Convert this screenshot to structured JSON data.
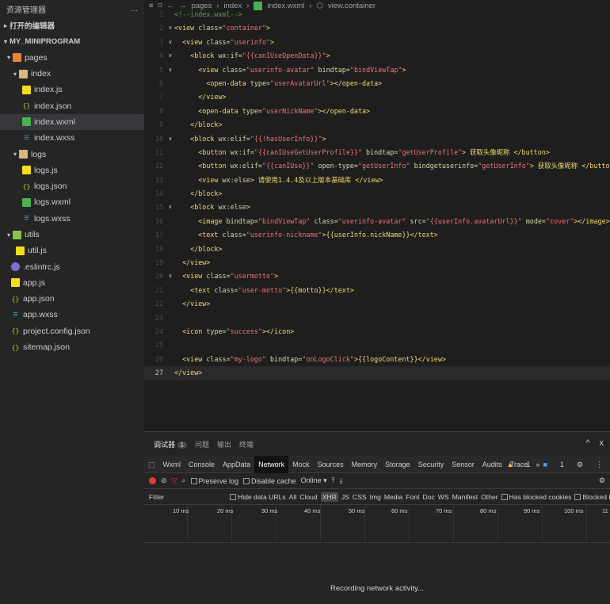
{
  "sidebar": {
    "title": "资源管理器",
    "more": "...",
    "sections": {
      "open_editors": "打开的编辑器",
      "project": "MY_MINIPROGRAM"
    },
    "tree": {
      "pages": "pages",
      "index": "index",
      "index_js": "index.js",
      "index_json": "index.json",
      "index_wxml": "index.wxml",
      "index_wxss": "index.wxss",
      "logs": "logs",
      "logs_js": "logs.js",
      "logs_json": "logs.json",
      "logs_wxml": "logs.wxml",
      "logs_wxss": "logs.wxss",
      "utils": "utils",
      "util_js": "util.js",
      "eslintrc": ".eslintrc.js",
      "app_js": "app.js",
      "app_json": "app.json",
      "app_wxss": "app.wxss",
      "project_config": "project.config.json",
      "sitemap": "sitemap.json"
    }
  },
  "breadcrumb": {
    "p1": "pages",
    "p2": "index",
    "p3": "index.wxml",
    "p4": "view.container"
  },
  "code": {
    "active_line": "27",
    "l1": "<!--index.wxml-->",
    "l2a": "<view ",
    "l2b": "class=",
    "l2c": "\"container\"",
    "l2d": ">",
    "l3a": "<view ",
    "l3b": "class=",
    "l3c": "\"userinfo\"",
    "l3d": ">",
    "l4a": "<block ",
    "l4b": "wx:if=",
    "l4c": "\"{{canIUseOpenData}}\"",
    "l4d": ">",
    "l5a": "<view ",
    "l5b": "class=",
    "l5c": "\"userinfo-avatar\"",
    "l5d": " bindtap=",
    "l5e": "\"bindViewTap\"",
    "l5f": ">",
    "l6a": "<open-data ",
    "l6b": "type=",
    "l6c": "\"userAvatarUrl\"",
    "l6d": "></open-data>",
    "l7": "</view>",
    "l8a": "<open-data ",
    "l8b": "type=",
    "l8c": "\"userNickName\"",
    "l8d": "></open-data>",
    "l9": "</block>",
    "l10a": "<block ",
    "l10b": "wx:elif=",
    "l10c": "\"{{!hasUserInfo}}\"",
    "l10d": ">",
    "l11a": "<button ",
    "l11b": "wx:if=",
    "l11c": "\"{{canIUseGetUserProfile}}\"",
    "l11d": " bindtap=",
    "l11e": "\"getUserProfile\"",
    "l11f": "> 获取头像昵称 </button>",
    "l12a": "<button ",
    "l12b": "wx:elif=",
    "l12c": "\"{{canIUse}}\"",
    "l12d": " open-type=",
    "l12e": "\"getUserInfo\"",
    "l12f": " bindgetuserinfo=",
    "l12g": "\"getUserInfo\"",
    "l12h": "> 获取头像昵称 </button>",
    "l13a": "<view ",
    "l13b": "wx:else",
    "l13c": "> 请使用1.4.4及以上版本基础库 </view>",
    "l14": "</block>",
    "l15a": "<block ",
    "l15b": "wx:else",
    "l15c": ">",
    "l16a": "<image ",
    "l16b": "bindtap=",
    "l16c": "\"bindViewTap\"",
    "l16d": " class=",
    "l16e": "\"userinfo-avatar\"",
    "l16f": " src=",
    "l16g": "\"{{userInfo.avatarUrl}}\"",
    "l16h": " mode=",
    "l16i": "\"cover\"",
    "l16j": "></image>",
    "l17a": "<text ",
    "l17b": "class=",
    "l17c": "\"userinfo-nickname\"",
    "l17d": ">{{userInfo.nickName}}</text>",
    "l18": "</block>",
    "l19": "</view>",
    "l20a": "<view ",
    "l20b": "class=",
    "l20c": "\"usermotto\"",
    "l20d": ">",
    "l21a": "<text ",
    "l21b": "class=",
    "l21c": "\"user-motto\"",
    "l21d": ">{{motto}}</text>",
    "l22": "</view>",
    "l24a": "<icon ",
    "l24b": "type=",
    "l24c": "\"success\"",
    "l24d": "></icon>",
    "l26a": "<view ",
    "l26b": "class=",
    "l26c": "\"my-logo\"",
    "l26d": " bindtap=",
    "l26e": "\"onLogoClick\"",
    "l26f": ">{{logoContent}}</view>",
    "l27": "</view>"
  },
  "devtools": {
    "tabs": {
      "debugger": "调试器",
      "debugger_count": "1",
      "problems": "问题",
      "output": "输出",
      "terminal": "终端"
    },
    "window": {
      "up": "^",
      "close": "x"
    },
    "panels": [
      "Wxml",
      "Console",
      "AppData",
      "Network",
      "Mock",
      "Sources",
      "Memory",
      "Storage",
      "Security",
      "Sensor",
      "Audits",
      "Trace"
    ],
    "panel_more": "»",
    "warnings": "1",
    "infos": "1",
    "toolbar": {
      "preserve_log": "Preserve log",
      "disable_cache": "Disable cache",
      "online": "Online"
    },
    "filter": {
      "label": "Filter",
      "hide_data_urls": "Hide data URLs",
      "types": [
        "All",
        "Cloud",
        "XHR",
        "JS",
        "CSS",
        "Img",
        "Media",
        "Font",
        "Doc",
        "WS",
        "Manifest",
        "Other"
      ],
      "has_blocked_cookies": "Has blocked cookies",
      "blocked_requests": "Blocked Requests"
    },
    "timeline_ticks": [
      "10 ms",
      "20 ms",
      "30 ms",
      "40 ms",
      "50 ms",
      "60 ms",
      "70 ms",
      "80 ms",
      "90 ms",
      "100 ms",
      "11"
    ],
    "status": "Recording network activity..."
  }
}
